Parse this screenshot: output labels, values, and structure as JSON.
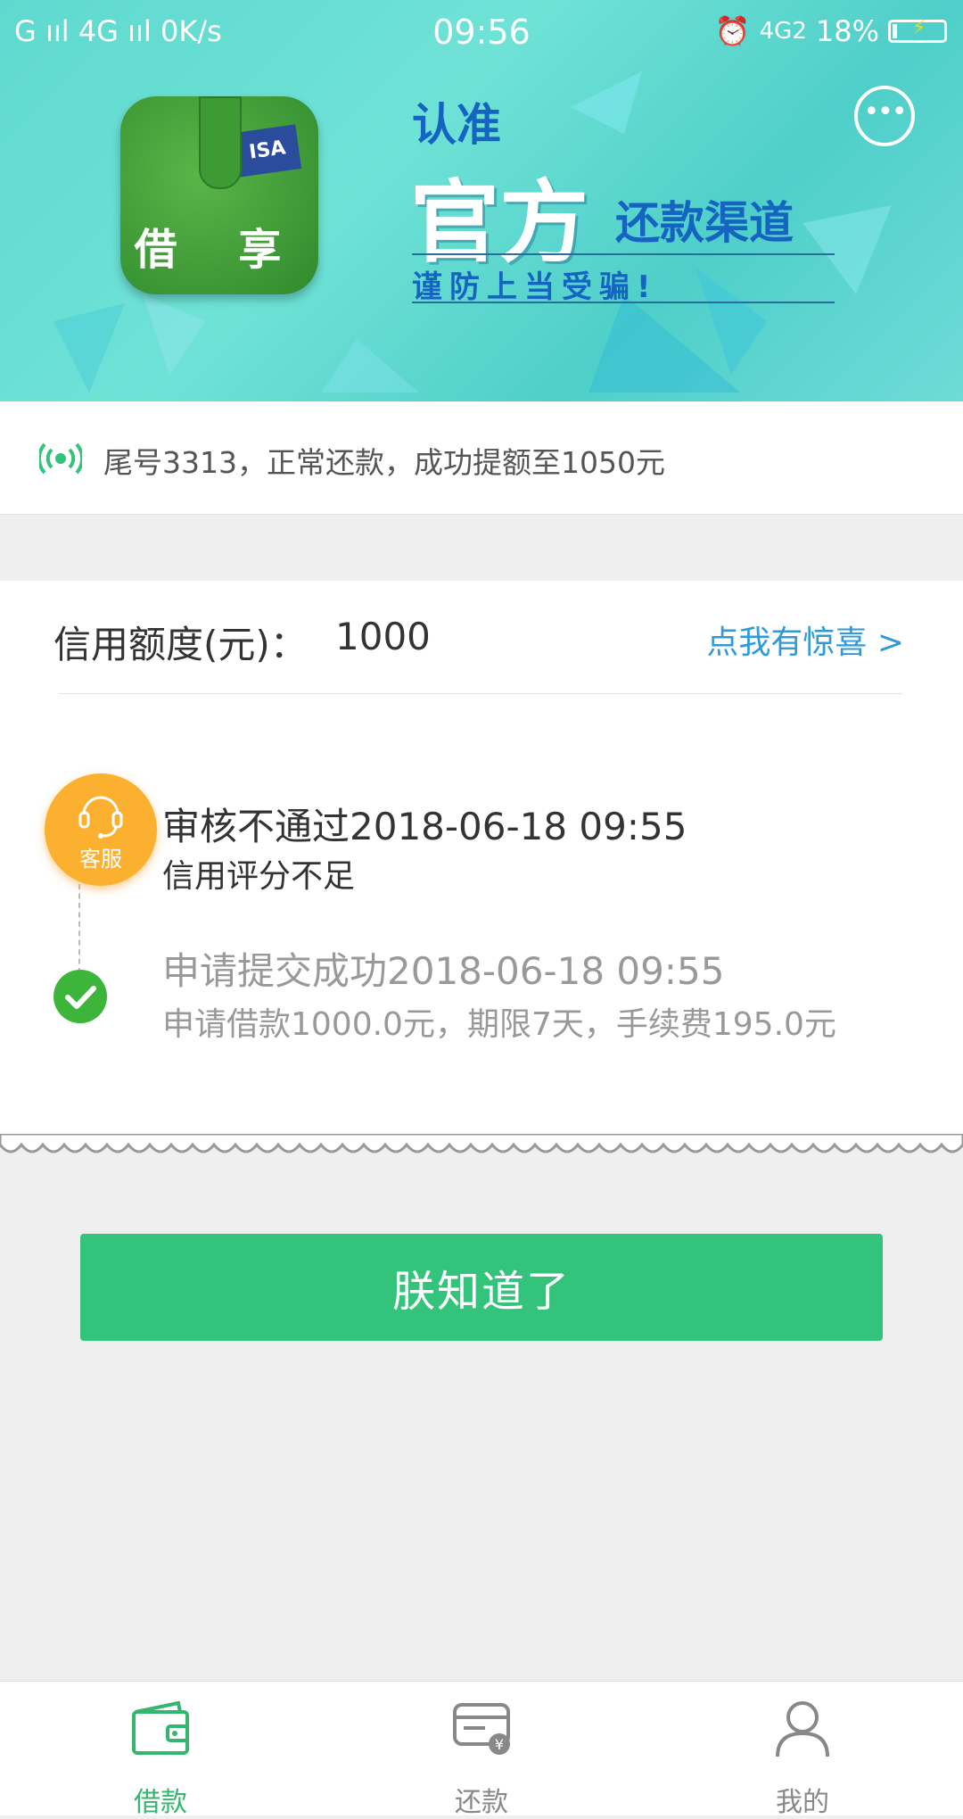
{
  "status_bar": {
    "left": "G ııl 4G ııl 0K/s",
    "time": "09:56",
    "network": "4G2",
    "battery": "18%"
  },
  "banner": {
    "app_name": "借 享",
    "card_text": "ISA",
    "slogan_line1": "认准",
    "slogan_line2": "官方",
    "slogan_line3": "还款渠道",
    "slogan_line4": "谨防上当受骗!",
    "message_icon": "chat-bubble-icon"
  },
  "notice": {
    "icon": "broadcast-icon",
    "text": "尾号3313，正常还款，成功提额至1050元"
  },
  "credit": {
    "label": "信用额度(元)：",
    "value": "1000",
    "surprise_link": "点我有惊喜 >"
  },
  "timeline": {
    "badge_label": "客服",
    "events": [
      {
        "title": "审核不通过2018-06-18 09:55",
        "subtitle": "信用评分不足"
      },
      {
        "title": "申请提交成功2018-06-18 09:55",
        "subtitle": "申请借款1000.0元，期限7天，手续费195.0元"
      }
    ]
  },
  "confirm_button": "朕知道了",
  "tabs": [
    {
      "label": "借款",
      "icon": "wallet-icon",
      "active": true
    },
    {
      "label": "还款",
      "icon": "card-yuan-icon",
      "active": false
    },
    {
      "label": "我的",
      "icon": "user-icon",
      "active": false
    }
  ],
  "colors": {
    "primary_green": "#33c37a",
    "active_tab": "#35b56e",
    "inactive_tab": "#888888",
    "link_blue": "#2f9ad8",
    "badge_orange": "#fbb030",
    "banner_teal": "#5fd9cf"
  }
}
